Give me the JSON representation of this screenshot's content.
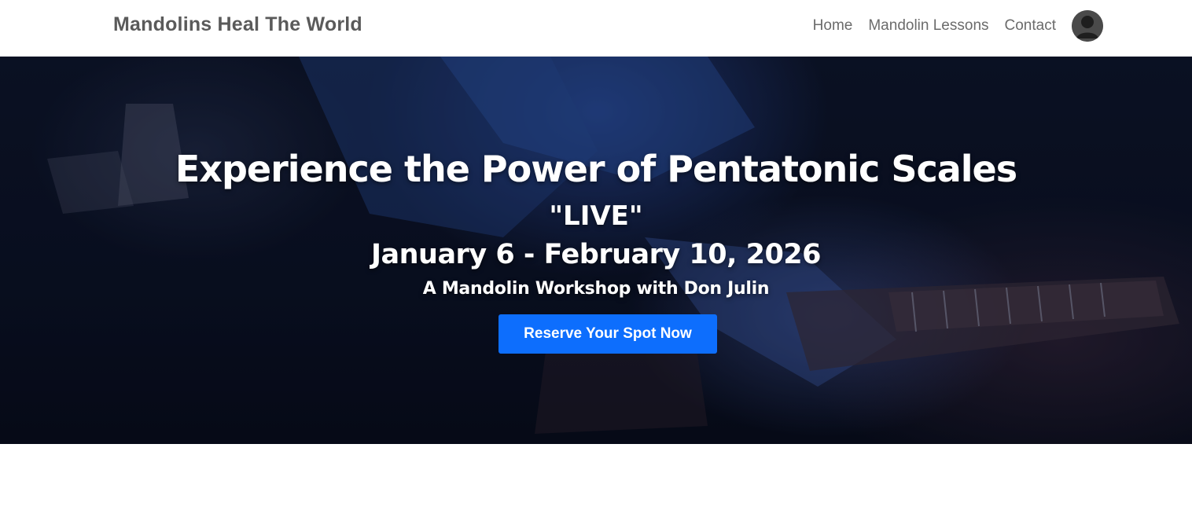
{
  "site": {
    "brand": "Mandolins Heal The World"
  },
  "nav": {
    "links": [
      "Home",
      "Mandolin Lessons",
      "Contact"
    ]
  },
  "hero": {
    "title": "Experience the Power of Pentatonic Scales",
    "live": "\"LIVE\"",
    "dates": "January 6 - February 10, 2026",
    "subtitle": "A Mandolin Workshop with Don Julin",
    "cta_label": "Reserve Your Spot Now"
  },
  "icons": {
    "avatar": "user-avatar-icon"
  },
  "colors": {
    "cta": "#0d6efd",
    "hero_bg": "#0a1022",
    "brand_text": "#5a5a5a"
  }
}
